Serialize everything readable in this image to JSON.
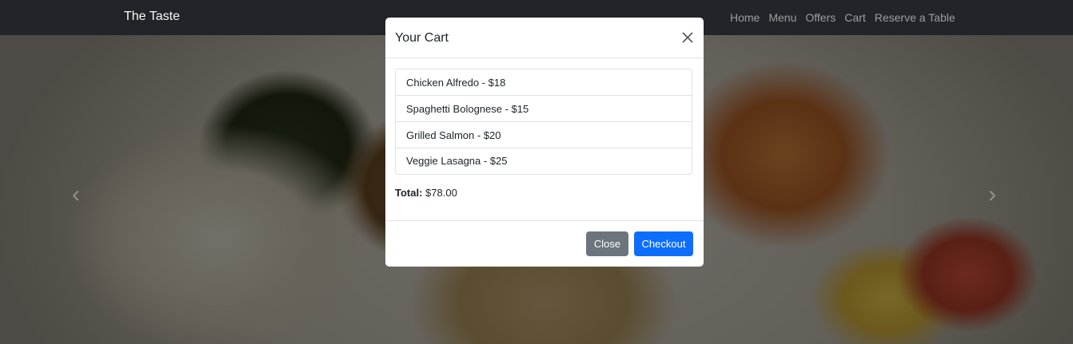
{
  "navbar": {
    "brand": "The Taste",
    "links": [
      "Home",
      "Menu",
      "Offers",
      "Cart",
      "Reserve a Table"
    ]
  },
  "carousel": {
    "prev_icon": "chevron-left-icon",
    "next_icon": "chevron-right-icon"
  },
  "modal": {
    "title": "Your Cart",
    "close_icon": "close-icon",
    "items": [
      "Chicken Alfredo - $18",
      "Spaghetti Bolognese - $15",
      "Grilled Salmon - $20",
      "Veggie Lasagna - $25"
    ],
    "total_label": "Total:",
    "total_value": "$78.00",
    "close_label": "Close",
    "checkout_label": "Checkout"
  },
  "colors": {
    "navbar_bg": "#212529",
    "primary": "#0d6efd",
    "secondary": "#6c757d"
  }
}
